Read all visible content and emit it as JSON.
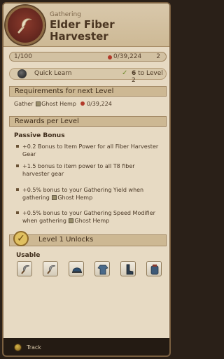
{
  "header": {
    "subtitle": "Gathering",
    "title": "Elder Fiber Harvester",
    "emblem_icon": "sickle-icon"
  },
  "progress": {
    "current_level": "1/100",
    "fame": "0/39,224",
    "next_level": "2",
    "fill_fraction": 0.0
  },
  "quick_learn": {
    "label": "Quick Learn",
    "right_prefix": "6",
    "right_suffix": "to Level 2"
  },
  "requirements": {
    "heading": "Requirements for next Level",
    "prefix": "Gather",
    "resource": "Ghost Hemp",
    "amount": "0/39,224"
  },
  "rewards": {
    "heading": "Rewards per Level",
    "passive_title": "Passive Bonus",
    "bonuses": [
      "+0.2 Bonus to Item Power for all Fiber Harvester Gear",
      "+1.5 bonus to item power to all T8 fiber harvester gear",
      "+0.5% bonus to your Gathering Yield when gathering",
      "+0.5% bonus to your Gathering Speed Modifier when gathering"
    ],
    "bonus_resource": "Ghost Hemp"
  },
  "unlocks": {
    "heading": "Level 1 Unlocks",
    "usable_label": "Usable",
    "items": [
      "sickle-item",
      "sickle-item",
      "cap-item",
      "garment-item",
      "boots-item",
      "backpack-item"
    ]
  },
  "footer": {
    "track_label": "Track"
  },
  "colors": {
    "panel_bg": "#e7dac3",
    "header_bg": "#cdb995",
    "emblem": "#6b2a21",
    "fame_red": "#b23a2a",
    "accent_gold": "#e0c060"
  }
}
